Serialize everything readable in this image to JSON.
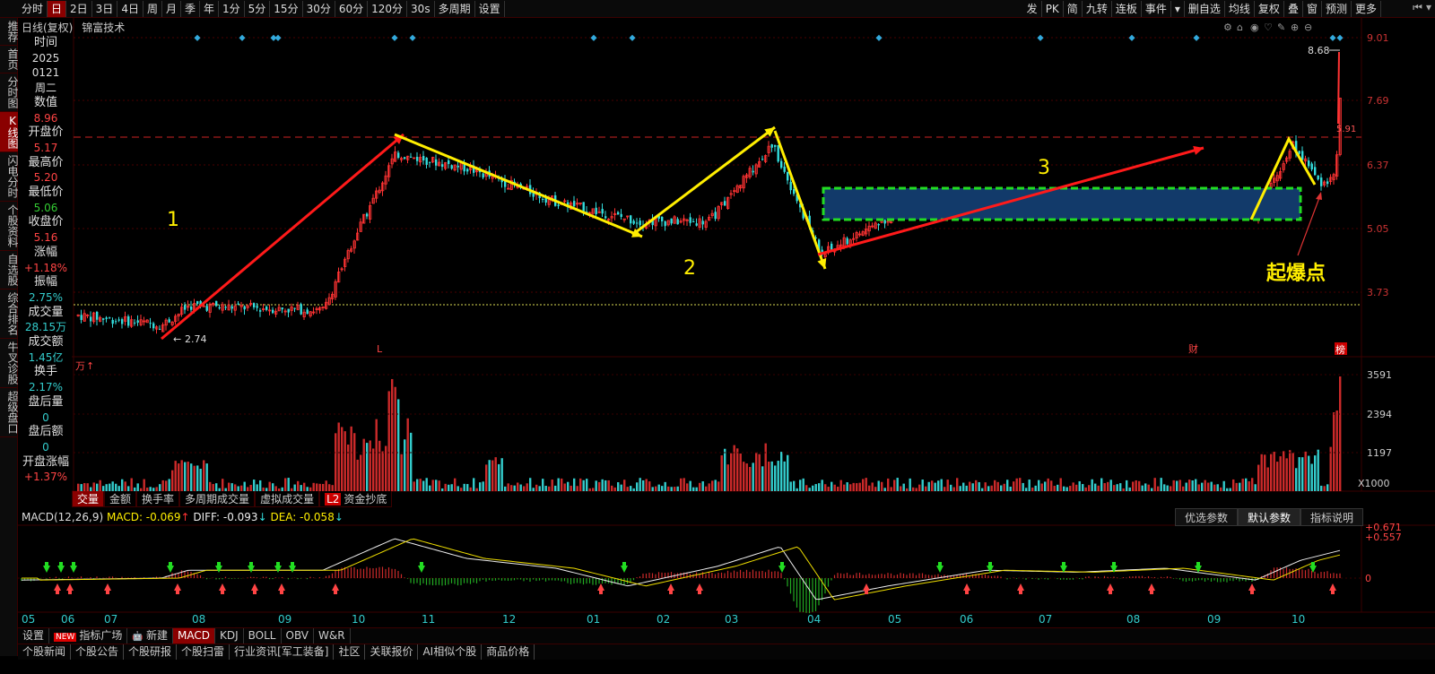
{
  "topbar": {
    "left": [
      "分时",
      "日",
      "2日",
      "3日",
      "4日",
      "周",
      "月",
      "季",
      "年",
      "1分",
      "5分",
      "15分",
      "30分",
      "60分",
      "120分",
      "30s",
      "多周期",
      "设置"
    ],
    "active": "日",
    "right": [
      "发",
      "PK",
      "简",
      "九转",
      "连板",
      "事件",
      "▾",
      "删自选",
      "均线",
      "复权",
      "叠",
      "窗",
      "预测",
      "更多"
    ],
    "win_controls": [
      "⏮",
      "▾"
    ]
  },
  "sidebar": {
    "tabs": [
      "推荐",
      "首页",
      "分时图",
      "K线图",
      "闪电分时",
      "个股资料",
      "自选股",
      "综合排名",
      "牛叉诊股",
      "超级盘口"
    ],
    "active": "K线图"
  },
  "chart_title": {
    "period": "日线(复权)",
    "name": "锦富技术"
  },
  "info": [
    {
      "label": "时间",
      "values": [
        "2025",
        "0121",
        "周二"
      ],
      "color": "w"
    },
    {
      "label": "数值",
      "values": [
        "8.96"
      ],
      "color": "r"
    },
    {
      "label": "开盘价",
      "values": [
        "5.17"
      ],
      "color": "r"
    },
    {
      "label": "最高价",
      "values": [
        "5.20"
      ],
      "color": "r"
    },
    {
      "label": "最低价",
      "values": [
        "5.06"
      ],
      "color": "g"
    },
    {
      "label": "收盘价",
      "values": [
        "5.16"
      ],
      "color": "r"
    },
    {
      "label": "涨幅",
      "values": [
        "+1.18%"
      ],
      "color": "r"
    },
    {
      "label": "振幅",
      "values": [
        "2.75%"
      ],
      "color": "c"
    },
    {
      "label": "成交量",
      "values": [
        "28.15万"
      ],
      "color": "c"
    },
    {
      "label": "成交额",
      "values": [
        "1.45亿"
      ],
      "color": "c"
    },
    {
      "label": "换手",
      "values": [
        "2.17%"
      ],
      "color": "c"
    },
    {
      "label": "盘后量",
      "values": [
        "0"
      ],
      "color": "c"
    },
    {
      "label": "盘后额",
      "values": [
        "0"
      ],
      "color": "c"
    },
    {
      "label": "开盘涨幅",
      "values": [
        "+1.37%"
      ],
      "color": "r"
    }
  ],
  "price_axis": [
    "9.01",
    "7.69",
    "6.37",
    "5.05",
    "3.73"
  ],
  "price_annotations": {
    "high": "8.68",
    "low": "2.74",
    "mid": "5.91"
  },
  "markers": {
    "l": "L",
    "cai": "财",
    "bang": "榜"
  },
  "chart_labels": {
    "n1": "1",
    "n2": "2",
    "n3": "3",
    "explode": "起爆点"
  },
  "volume": {
    "unit": "万",
    "axis": [
      "3591",
      "2394",
      "1197"
    ],
    "multiplier": "X1000"
  },
  "indicator_tabs": [
    "交量",
    "金额",
    "换手率",
    "多周期成交量",
    "虚拟成交量",
    "资金抄底"
  ],
  "indicator_active": "交量",
  "l2_badge": "L2",
  "macd_header": {
    "name": "MACD(12,26,9)",
    "macd": "MACD: -0.069",
    "diff": "DIFF: -0.093",
    "dea": "DEA: -0.058"
  },
  "macd_axis": [
    "0.671",
    "0.557",
    "0"
  ],
  "param_buttons": [
    "优选参数",
    "默认参数",
    "指标说明"
  ],
  "param_active": "默认参数",
  "x_months": [
    "05",
    "06",
    "07",
    "08",
    "09",
    "10",
    "11",
    "12",
    "01",
    "02",
    "03",
    "04",
    "05",
    "06",
    "07",
    "08",
    "09",
    "10"
  ],
  "bottom_tabs": [
    "设置",
    "指标广场",
    "新建",
    "MACD",
    "KDJ",
    "BOLL",
    "OBV",
    "W&R"
  ],
  "bottom_new_badge": "NEW",
  "bottom_active": "MACD",
  "news_tabs": [
    "个股新闻",
    "个股公告",
    "个股研报",
    "个股扫雷",
    "行业资讯[军工装备]",
    "社区",
    "关联报价",
    "AI相似个股",
    "商品价格"
  ],
  "colors": {
    "up": "#ff3333",
    "down": "#33dddd",
    "bg": "#000000",
    "grid": "#3a0000",
    "arrow_red": "#ff1a1a",
    "arrow_yellow": "#ffee00",
    "box": "#123a6a",
    "box_border": "#22dd22"
  }
}
